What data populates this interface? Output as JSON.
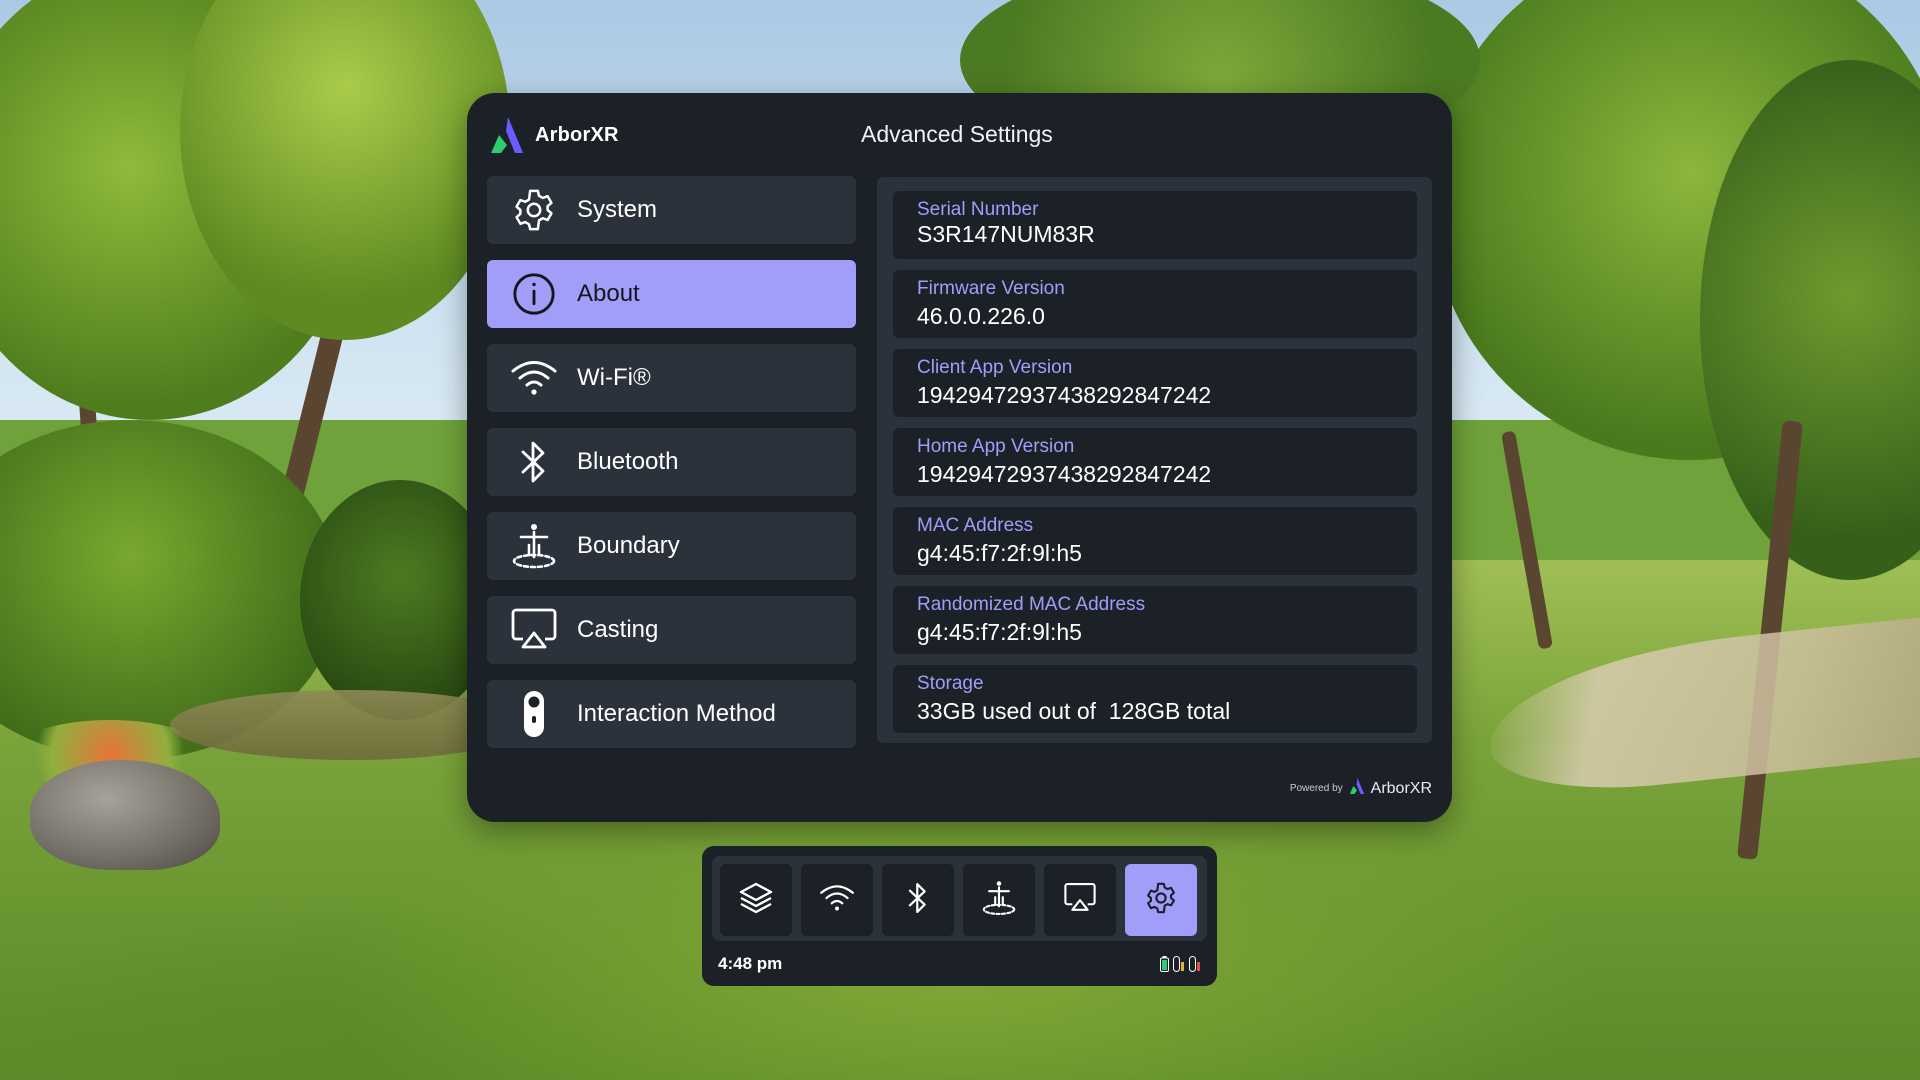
{
  "brand": {
    "name": "ArborXR"
  },
  "page_title": "Advanced Settings",
  "colors": {
    "accent": "#a09ef9",
    "panel_bg": "#1c2027",
    "item_bg": "#2b323c",
    "logo_green": "#2ecc71",
    "logo_purple": "#6a5cff"
  },
  "menu": {
    "items": [
      {
        "label": "System",
        "icon": "gear-icon",
        "active": false
      },
      {
        "label": "About",
        "icon": "info-icon",
        "active": true
      },
      {
        "label": "Wi-Fi®",
        "icon": "wifi-icon",
        "active": false
      },
      {
        "label": "Bluetooth",
        "icon": "bluetooth-icon",
        "active": false
      },
      {
        "label": "Boundary",
        "icon": "boundary-icon",
        "active": false
      },
      {
        "label": "Casting",
        "icon": "cast-icon",
        "active": false
      },
      {
        "label": "Interaction Method",
        "icon": "controller-icon",
        "active": false
      }
    ]
  },
  "about": {
    "fields": [
      {
        "label": "Serial Number",
        "value": "S3R147NUM83R"
      },
      {
        "label": "Firmware Version",
        "value": "46.0.0.226.0"
      },
      {
        "label": "Client App Version",
        "value": "1942947293743829284724​2"
      },
      {
        "label": "Home App Version",
        "value": "19429472937438292847242"
      },
      {
        "label": "MAC Address",
        "value": "g4:45:f7:2f:9l:h5"
      },
      {
        "label": "Randomized MAC Address",
        "value": "g4:45:f7:2f:9l:h5"
      },
      {
        "label": "Storage",
        "value": "33GB used out of  128GB total"
      }
    ]
  },
  "footer": {
    "powered_by": "Powered by",
    "brand": "ArborXR"
  },
  "dock": {
    "buttons": [
      {
        "icon": "layers-icon",
        "active": false
      },
      {
        "icon": "wifi-icon",
        "active": false
      },
      {
        "icon": "bluetooth-icon",
        "active": false
      },
      {
        "icon": "boundary-icon",
        "active": false
      },
      {
        "icon": "cast-icon",
        "active": false
      },
      {
        "icon": "gear-icon",
        "active": true
      }
    ],
    "time": "4:48 pm",
    "status_icons": [
      "battery-icon",
      "controller-left-battery-icon",
      "controller-right-battery-icon"
    ]
  }
}
